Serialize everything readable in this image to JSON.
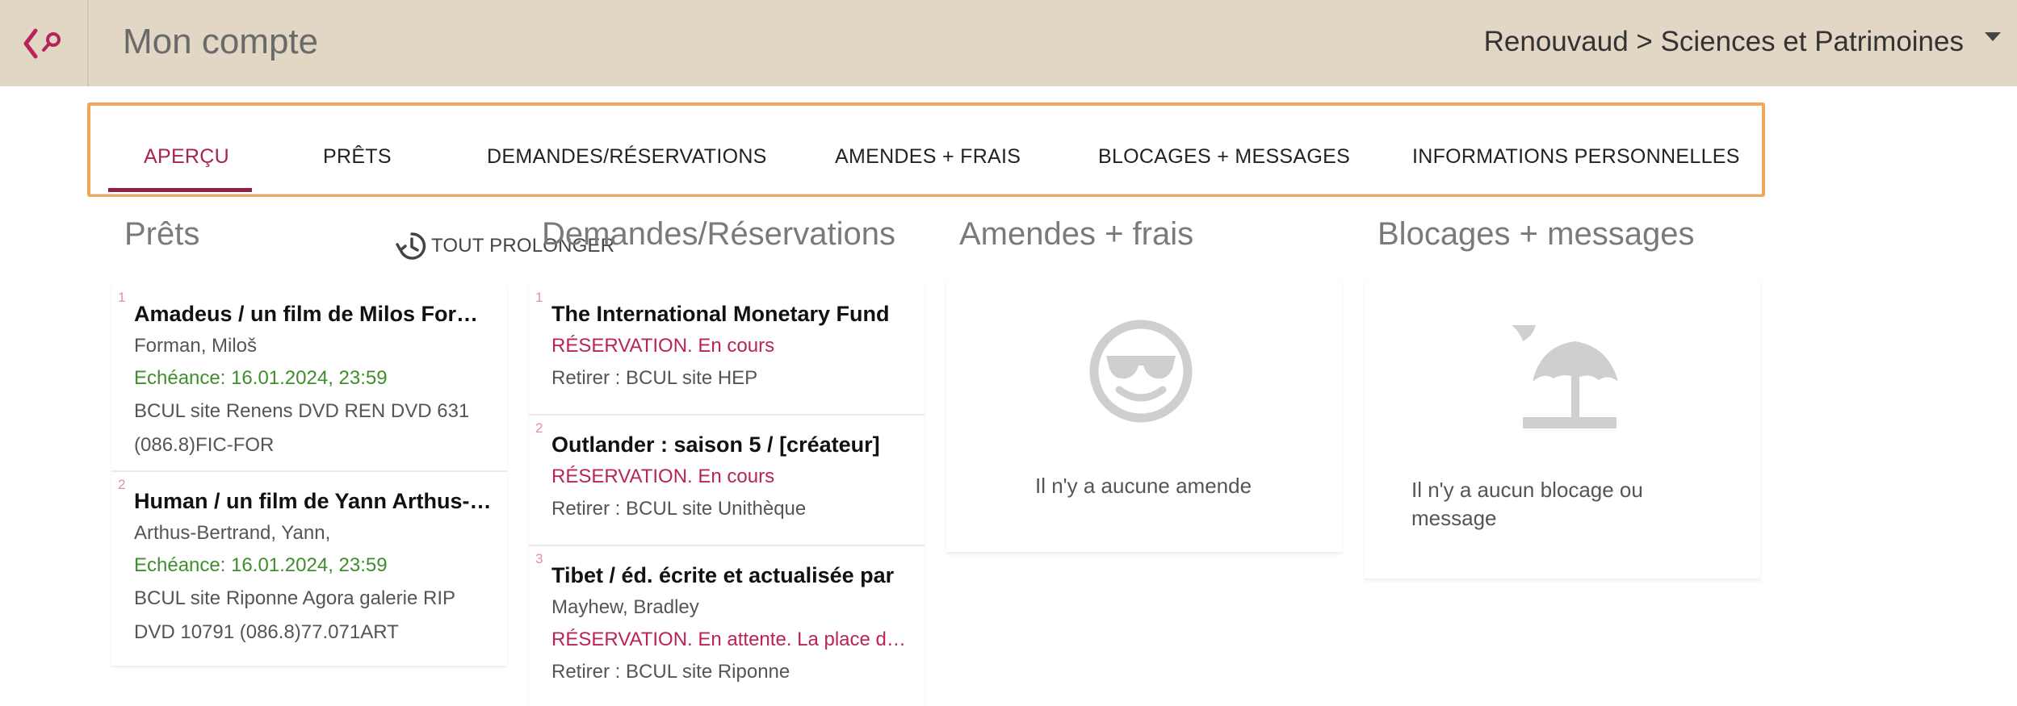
{
  "header": {
    "title": "Mon compte",
    "institution": "Renouvaud > Sciences et Patrimoines"
  },
  "tabs": [
    {
      "label": "APERÇU",
      "active": true
    },
    {
      "label": "PRÊTS"
    },
    {
      "label": "DEMANDES/RÉSERVATIONS"
    },
    {
      "label": "AMENDES + FRAIS"
    },
    {
      "label": "BLOCAGES + MESSAGES"
    },
    {
      "label": "INFORMATIONS PERSONNELLES"
    }
  ],
  "loans": {
    "title": "Prêts",
    "renew_all": "TOUT PROLONGER",
    "items": [
      {
        "num": "1",
        "title": "Amadeus / un film de Milos Forman",
        "author": "Forman, Miloš",
        "due": "Echéance: 16.01.2024, 23:59",
        "location": "BCUL site Renens DVD REN DVD 631 (086.8)FIC-FOR"
      },
      {
        "num": "2",
        "title": "Human / un film de Yann Arthus-Bertrand",
        "author": "Arthus-Bertrand, Yann,",
        "due": "Echéance: 16.01.2024, 23:59",
        "location": "BCUL site Riponne Agora galerie RIP DVD 10791 (086.8)77.071ART"
      }
    ]
  },
  "requests": {
    "title": "Demandes/Réservations",
    "items": [
      {
        "num": "1",
        "title": "The International Monetary Fund",
        "status": "RÉSERVATION. En cours",
        "pickup": "Retirer : BCUL site HEP"
      },
      {
        "num": "2",
        "title": "Outlander : saison 5 / [créateur]",
        "status": "RÉSERVATION. En cours",
        "pickup": "Retirer : BCUL site Unithèque"
      },
      {
        "num": "3",
        "title": "Tibet / éd. écrite et actualisée par",
        "author": "Mayhew, Bradley",
        "status": "RÉSERVATION. En attente. La place dans la file",
        "pickup": "Retirer : BCUL site Riponne"
      }
    ]
  },
  "fines": {
    "title": "Amendes + frais",
    "empty": "Il n'y a aucune amende"
  },
  "blocks": {
    "title": "Blocages + messages",
    "empty": "Il n'y a aucun blocage ou message"
  },
  "colors": {
    "header_bg": "#e2d6c5",
    "accent": "#a8234e",
    "due_green": "#3f8e2e",
    "highlight_border": "#f0a757"
  }
}
